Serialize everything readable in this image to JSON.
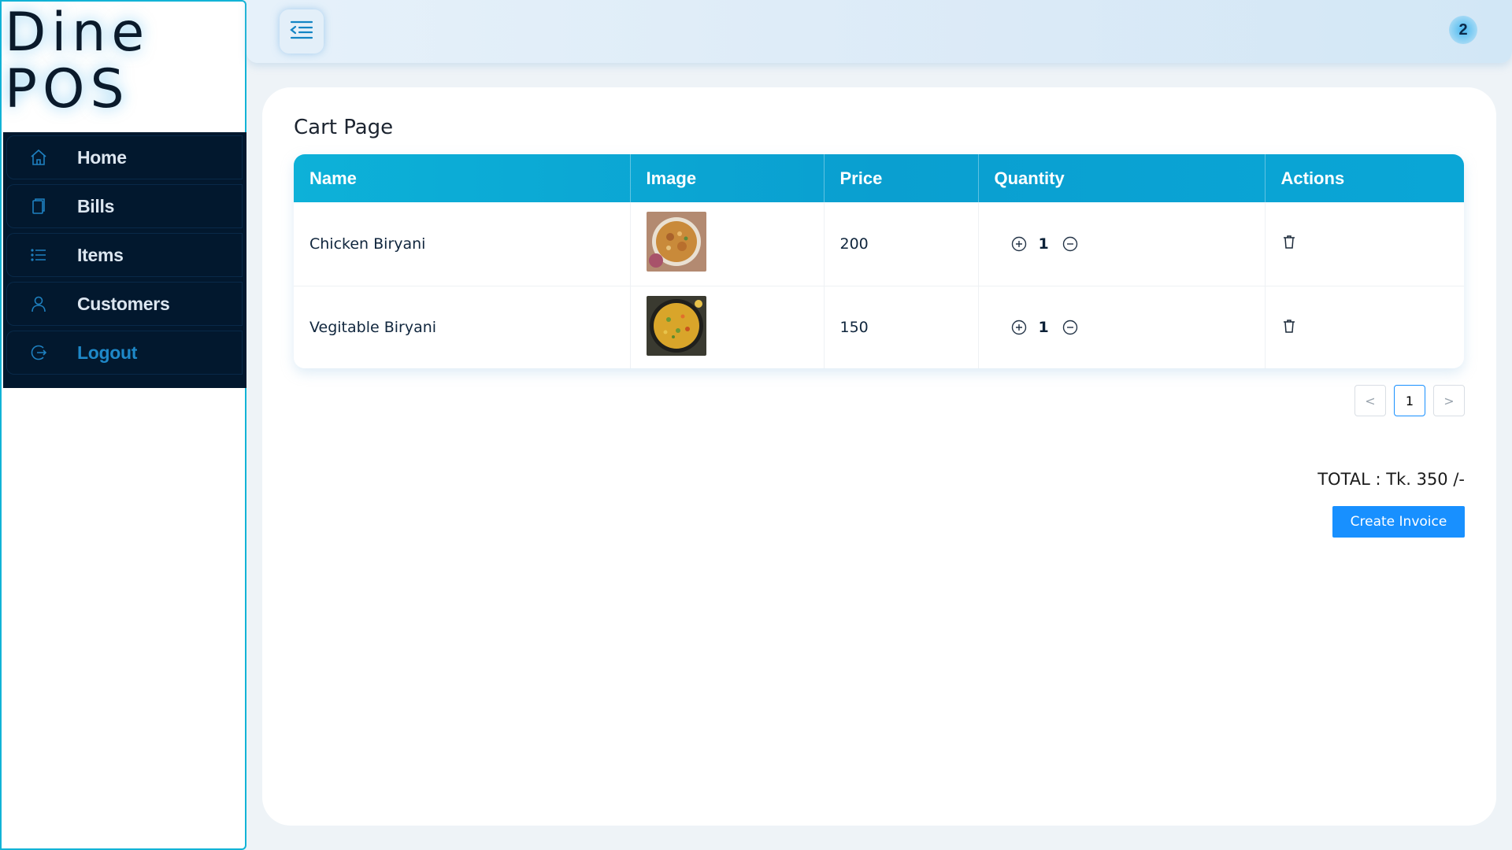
{
  "app": {
    "logo_line1": "Dine",
    "logo_line2": "POS"
  },
  "sidebar": {
    "items": [
      {
        "label": "Home",
        "icon": "home-icon"
      },
      {
        "label": "Bills",
        "icon": "bills-icon"
      },
      {
        "label": "Items",
        "icon": "list-icon"
      },
      {
        "label": "Customers",
        "icon": "user-icon"
      },
      {
        "label": "Logout",
        "icon": "logout-icon"
      }
    ]
  },
  "header": {
    "cart_count": "2",
    "toggle_icon": "menu-fold-icon"
  },
  "main": {
    "title": "Cart Page",
    "table": {
      "columns": [
        "Name",
        "Image",
        "Price",
        "Quantity",
        "Actions"
      ],
      "rows": [
        {
          "name": "Chicken Biryani",
          "price": "200",
          "quantity": "1",
          "image": "chicken-biryani-image"
        },
        {
          "name": "Vegitable Biryani",
          "price": "150",
          "quantity": "1",
          "image": "vegetable-biryani-image"
        }
      ]
    },
    "pagination": {
      "prev": "<",
      "current": "1",
      "next": ">"
    },
    "total": "TOTAL : Tk. 350 /-",
    "invoice_button": "Create Invoice"
  },
  "colors": {
    "sidebar_bg": "#02182e",
    "accent": "#0db1d8",
    "primary_button": "#1890ff"
  }
}
